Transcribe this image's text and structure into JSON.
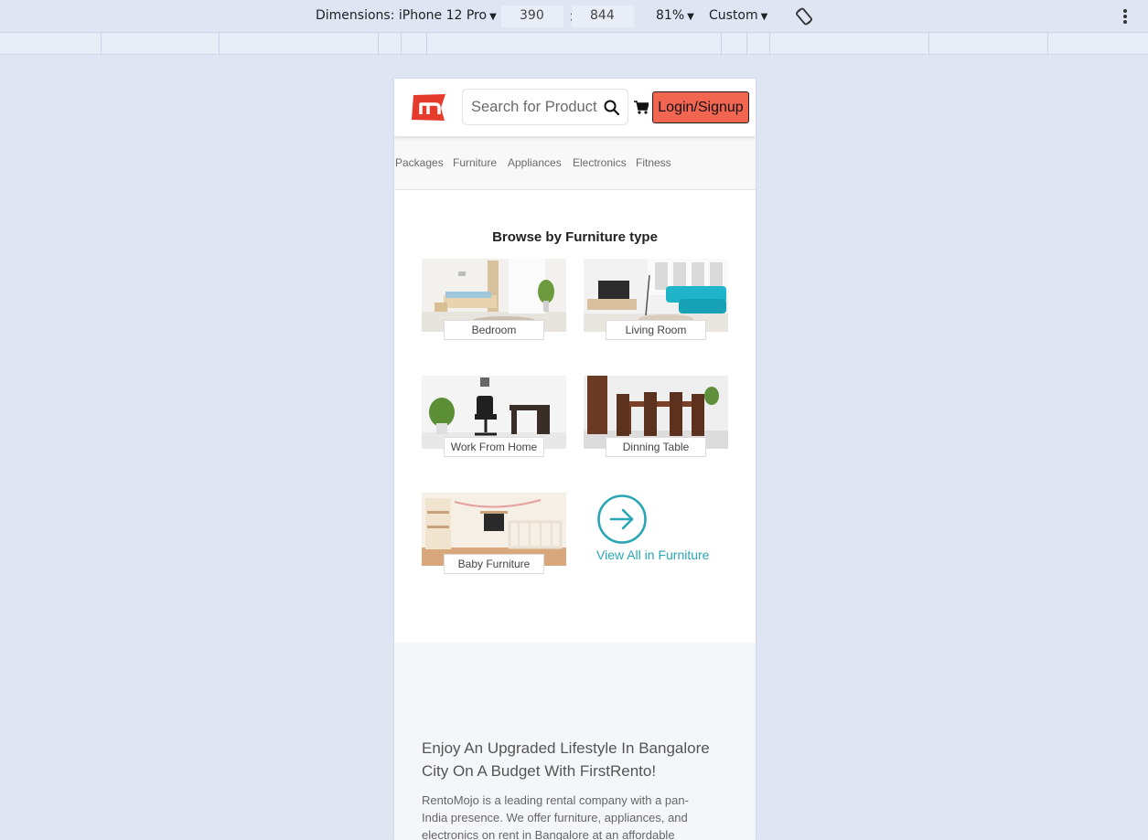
{
  "devtools": {
    "dimensions_label": "Dimensions: iPhone 12 Pro",
    "width_value": "390",
    "times": "×",
    "height_value": "844",
    "zoom": "81%",
    "throttle": "Custom"
  },
  "header": {
    "logo_letter": "m",
    "search_placeholder": "Search for Product",
    "login_label": "Login/Signup"
  },
  "nav": {
    "items": [
      "Packages",
      "Furniture",
      "Appliances",
      "Electronics",
      "Fitness"
    ]
  },
  "browse": {
    "title": "Browse by Furniture type",
    "tiles": [
      "Bedroom",
      "Living Room",
      "Work From Home",
      "Dinning Table",
      "Baby Furniture"
    ],
    "view_all": "View All in Furniture"
  },
  "about": {
    "heading": "Enjoy An Upgraded Lifestyle In Bangalore City On A Budget With FirstRento!",
    "body": "RentoMojo is a leading rental company with a pan-India presence. We offer furniture, appliances, and electronics on rent in Bangalore at an affordable"
  },
  "colors": {
    "brand_red": "#e53b2c",
    "login_bg": "#f26551",
    "accent_teal": "#2aa6b5"
  }
}
